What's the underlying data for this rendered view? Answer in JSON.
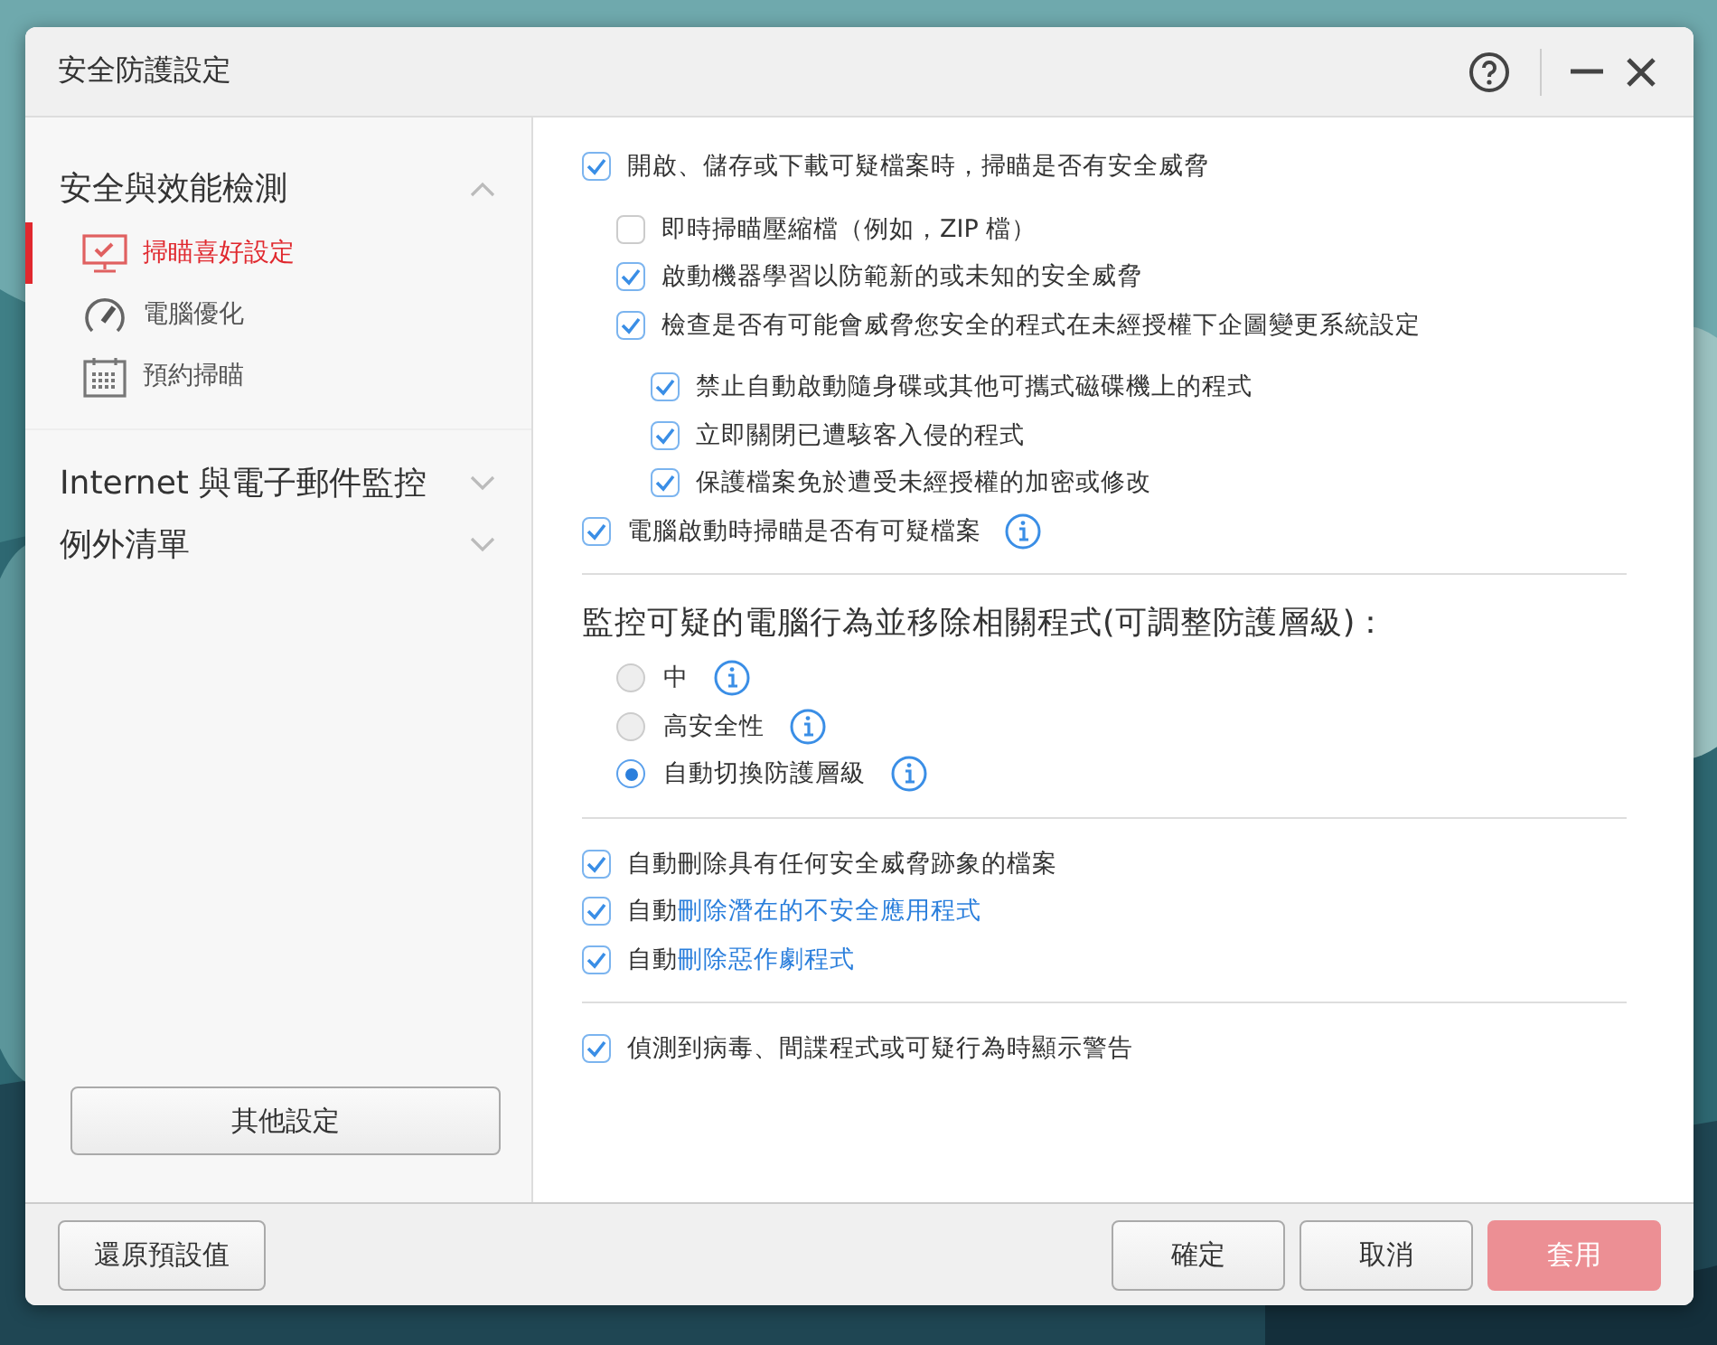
{
  "window": {
    "title": "安全防護設定"
  },
  "sidebar": {
    "groups": [
      {
        "label": "安全與效能檢測",
        "expanded": true,
        "items": [
          {
            "label": "掃瞄喜好設定",
            "selected": true
          },
          {
            "label": "電腦優化",
            "selected": false
          },
          {
            "label": "預約掃瞄",
            "selected": false
          }
        ]
      },
      {
        "label": "Internet 與電子郵件監控",
        "expanded": false
      },
      {
        "label": "例外清單",
        "expanded": false
      }
    ],
    "button": "其他設定"
  },
  "sections": [
    {
      "kind": "checks",
      "items": [
        {
          "label": "開啟、儲存或下載可疑檔案時，掃瞄是否有安全威脅",
          "checked": true,
          "children": [
            {
              "label": "即時掃瞄壓縮檔（例如，ZIP 檔）",
              "checked": false
            },
            {
              "label": "啟動機器學習以防範新的或未知的安全威脅",
              "checked": true
            },
            {
              "label": "檢查是否有可能會威脅您安全的程式在未經授權下企圖變更系統設定",
              "checked": true,
              "children": [
                {
                  "label": "禁止自動啟動隨身碟或其他可攜式磁碟機上的程式",
                  "checked": true
                },
                {
                  "label": "立即關閉已遭駭客入侵的程式",
                  "checked": true
                },
                {
                  "label": "保護檔案免於遭受未經授權的加密或修改",
                  "checked": true
                }
              ]
            }
          ]
        },
        {
          "label": "電腦啟動時掃瞄是否有可疑檔案",
          "checked": true,
          "info": true
        }
      ]
    },
    {
      "kind": "radios",
      "heading": "監控可疑的電腦行為並移除相關程式(可調整防護層級)：",
      "items": [
        {
          "label": "中",
          "selected": false,
          "info": true
        },
        {
          "label": "高安全性",
          "selected": false,
          "info": true
        },
        {
          "label": "自動切換防護層級",
          "selected": true,
          "info": true
        }
      ]
    },
    {
      "kind": "checks",
      "items": [
        {
          "label": "自動刪除具有任何安全威脅跡象的檔案",
          "checked": true
        },
        {
          "label": "自動",
          "link": "刪除潛在的不安全應用程式",
          "checked": true
        },
        {
          "label": "自動",
          "link": "刪除惡作劇程式",
          "checked": true
        }
      ]
    },
    {
      "kind": "checks",
      "items": [
        {
          "label": "偵測到病毒、間諜程式或可疑行為時顯示警告",
          "checked": true
        }
      ]
    }
  ],
  "footer": {
    "reset": "還原預設值",
    "buttons": [
      {
        "label": "確定",
        "kind": "normal"
      },
      {
        "label": "取消",
        "kind": "normal"
      },
      {
        "label": "套用",
        "kind": "primary"
      }
    ]
  }
}
